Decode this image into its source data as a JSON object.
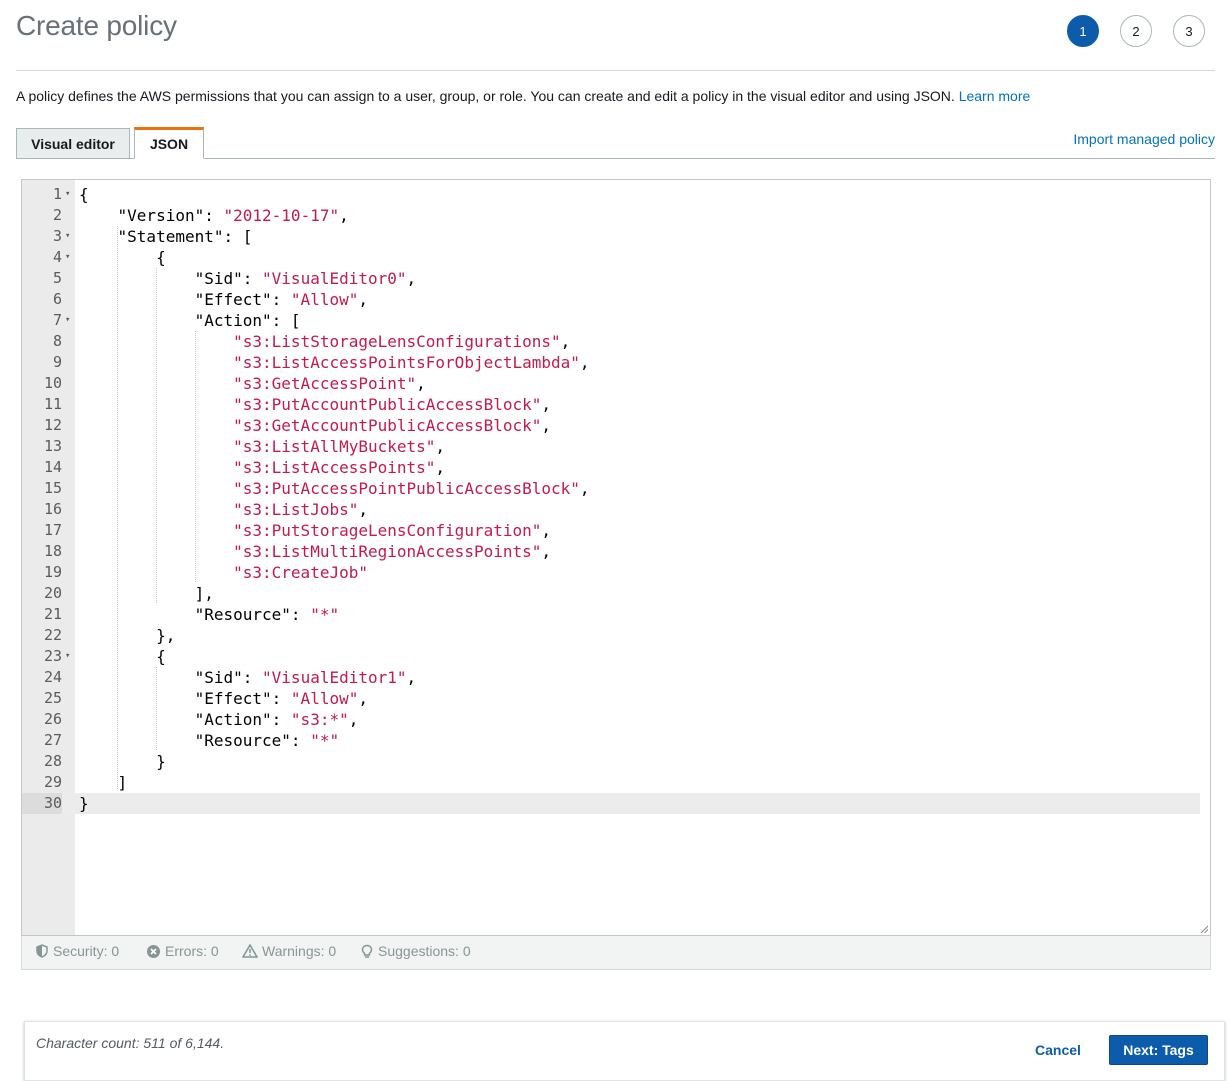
{
  "header": {
    "title": "Create policy",
    "steps": [
      "1",
      "2",
      "3"
    ],
    "description": "A policy defines the AWS permissions that you can assign to a user, group, or role. You can create and edit a policy in the visual editor and using JSON.",
    "learn_more": "Learn more"
  },
  "tabs": [
    {
      "label": "Visual editor"
    },
    {
      "label": "JSON"
    }
  ],
  "import_link": "Import managed policy",
  "editor": {
    "lines": [
      {
        "n": "1",
        "fold": true,
        "indent": 0,
        "parts": [
          [
            "p",
            "{"
          ]
        ]
      },
      {
        "n": "2",
        "fold": false,
        "indent": 1,
        "parts": [
          [
            "p",
            "\"Version\": "
          ],
          [
            "s",
            "\"2012-10-17\""
          ],
          [
            "p",
            ","
          ]
        ]
      },
      {
        "n": "3",
        "fold": true,
        "indent": 1,
        "parts": [
          [
            "p",
            "\"Statement\": ["
          ]
        ]
      },
      {
        "n": "4",
        "fold": true,
        "indent": 2,
        "parts": [
          [
            "p",
            "{"
          ]
        ]
      },
      {
        "n": "5",
        "fold": false,
        "indent": 3,
        "parts": [
          [
            "p",
            "\"Sid\": "
          ],
          [
            "s",
            "\"VisualEditor0\""
          ],
          [
            "p",
            ","
          ]
        ]
      },
      {
        "n": "6",
        "fold": false,
        "indent": 3,
        "parts": [
          [
            "p",
            "\"Effect\": "
          ],
          [
            "s",
            "\"Allow\""
          ],
          [
            "p",
            ","
          ]
        ]
      },
      {
        "n": "7",
        "fold": true,
        "indent": 3,
        "parts": [
          [
            "p",
            "\"Action\": ["
          ]
        ]
      },
      {
        "n": "8",
        "fold": false,
        "indent": 4,
        "parts": [
          [
            "s",
            "\"s3:ListStorageLensConfigurations\""
          ],
          [
            "p",
            ","
          ]
        ]
      },
      {
        "n": "9",
        "fold": false,
        "indent": 4,
        "parts": [
          [
            "s",
            "\"s3:ListAccessPointsForObjectLambda\""
          ],
          [
            "p",
            ","
          ]
        ]
      },
      {
        "n": "10",
        "fold": false,
        "indent": 4,
        "parts": [
          [
            "s",
            "\"s3:GetAccessPoint\""
          ],
          [
            "p",
            ","
          ]
        ]
      },
      {
        "n": "11",
        "fold": false,
        "indent": 4,
        "parts": [
          [
            "s",
            "\"s3:PutAccountPublicAccessBlock\""
          ],
          [
            "p",
            ","
          ]
        ]
      },
      {
        "n": "12",
        "fold": false,
        "indent": 4,
        "parts": [
          [
            "s",
            "\"s3:GetAccountPublicAccessBlock\""
          ],
          [
            "p",
            ","
          ]
        ]
      },
      {
        "n": "13",
        "fold": false,
        "indent": 4,
        "parts": [
          [
            "s",
            "\"s3:ListAllMyBuckets\""
          ],
          [
            "p",
            ","
          ]
        ]
      },
      {
        "n": "14",
        "fold": false,
        "indent": 4,
        "parts": [
          [
            "s",
            "\"s3:ListAccessPoints\""
          ],
          [
            "p",
            ","
          ]
        ]
      },
      {
        "n": "15",
        "fold": false,
        "indent": 4,
        "parts": [
          [
            "s",
            "\"s3:PutAccessPointPublicAccessBlock\""
          ],
          [
            "p",
            ","
          ]
        ]
      },
      {
        "n": "16",
        "fold": false,
        "indent": 4,
        "parts": [
          [
            "s",
            "\"s3:ListJobs\""
          ],
          [
            "p",
            ","
          ]
        ]
      },
      {
        "n": "17",
        "fold": false,
        "indent": 4,
        "parts": [
          [
            "s",
            "\"s3:PutStorageLensConfiguration\""
          ],
          [
            "p",
            ","
          ]
        ]
      },
      {
        "n": "18",
        "fold": false,
        "indent": 4,
        "parts": [
          [
            "s",
            "\"s3:ListMultiRegionAccessPoints\""
          ],
          [
            "p",
            ","
          ]
        ]
      },
      {
        "n": "19",
        "fold": false,
        "indent": 4,
        "parts": [
          [
            "s",
            "\"s3:CreateJob\""
          ]
        ]
      },
      {
        "n": "20",
        "fold": false,
        "indent": 3,
        "parts": [
          [
            "p",
            "],"
          ]
        ]
      },
      {
        "n": "21",
        "fold": false,
        "indent": 3,
        "parts": [
          [
            "p",
            "\"Resource\": "
          ],
          [
            "s",
            "\"*\""
          ]
        ]
      },
      {
        "n": "22",
        "fold": false,
        "indent": 2,
        "parts": [
          [
            "p",
            "},"
          ]
        ]
      },
      {
        "n": "23",
        "fold": true,
        "indent": 2,
        "parts": [
          [
            "p",
            "{"
          ]
        ]
      },
      {
        "n": "24",
        "fold": false,
        "indent": 3,
        "parts": [
          [
            "p",
            "\"Sid\": "
          ],
          [
            "s",
            "\"VisualEditor1\""
          ],
          [
            "p",
            ","
          ]
        ]
      },
      {
        "n": "25",
        "fold": false,
        "indent": 3,
        "parts": [
          [
            "p",
            "\"Effect\": "
          ],
          [
            "s",
            "\"Allow\""
          ],
          [
            "p",
            ","
          ]
        ]
      },
      {
        "n": "26",
        "fold": false,
        "indent": 3,
        "parts": [
          [
            "p",
            "\"Action\": "
          ],
          [
            "s",
            "\"s3:*\""
          ],
          [
            "p",
            ","
          ]
        ]
      },
      {
        "n": "27",
        "fold": false,
        "indent": 3,
        "parts": [
          [
            "p",
            "\"Resource\": "
          ],
          [
            "s",
            "\"*\""
          ]
        ]
      },
      {
        "n": "28",
        "fold": false,
        "indent": 2,
        "parts": [
          [
            "p",
            "}"
          ]
        ]
      },
      {
        "n": "29",
        "fold": false,
        "indent": 1,
        "parts": [
          [
            "p",
            "]"
          ]
        ]
      },
      {
        "n": "30",
        "fold": false,
        "indent": 0,
        "parts": [
          [
            "p",
            "}"
          ]
        ],
        "active": true
      }
    ]
  },
  "status_bar": {
    "security": "Security: 0",
    "errors": "Errors: 0",
    "warnings": "Warnings: 0",
    "suggestions": "Suggestions: 0"
  },
  "footer": {
    "char_count": "Character count: 511 of 6,144.",
    "cancel": "Cancel",
    "next": "Next: Tags"
  },
  "colors": {
    "primary": "#0d5cab",
    "link": "#0073bb",
    "tab_accent": "#ec7211",
    "json_string": "#c41a4c"
  }
}
